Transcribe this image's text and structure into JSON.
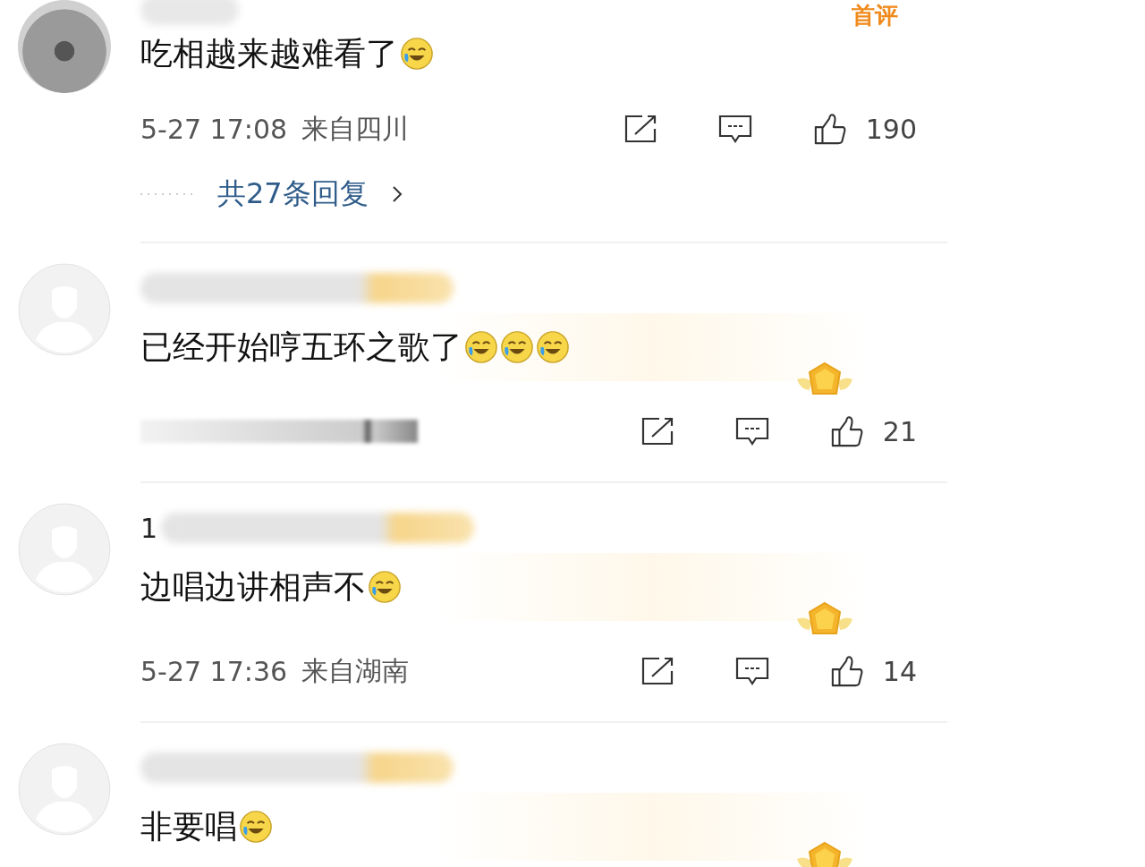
{
  "comments": [
    {
      "kind": "photo-avatar",
      "first_badge": "首评",
      "text": "吃相越来越难看了",
      "emojis": [
        {
          "kind": "laugh-cry"
        }
      ],
      "time": "5-27 17:08",
      "location": "来自四川",
      "likes": "190",
      "replies": "共27条回复"
    },
    {
      "kind": "default-avatar",
      "text": "已经开始哼五环之歌了",
      "emojis": [
        {
          "kind": "laugh-cry"
        },
        {
          "kind": "laugh-cry"
        },
        {
          "kind": "laugh-cry"
        }
      ],
      "medal": true,
      "meta_blurred": true,
      "likes": "21"
    },
    {
      "kind": "default-avatar",
      "name_prefix": "1",
      "text": "边唱边讲相声不",
      "emojis": [
        {
          "kind": "laugh-cry"
        }
      ],
      "medal": true,
      "time": "5-27 17:36",
      "location": "来自湖南",
      "likes": "14"
    },
    {
      "kind": "default-avatar",
      "text": "非要唱",
      "emojis": [
        {
          "kind": "laugh-cry"
        }
      ],
      "medal": true
    }
  ]
}
